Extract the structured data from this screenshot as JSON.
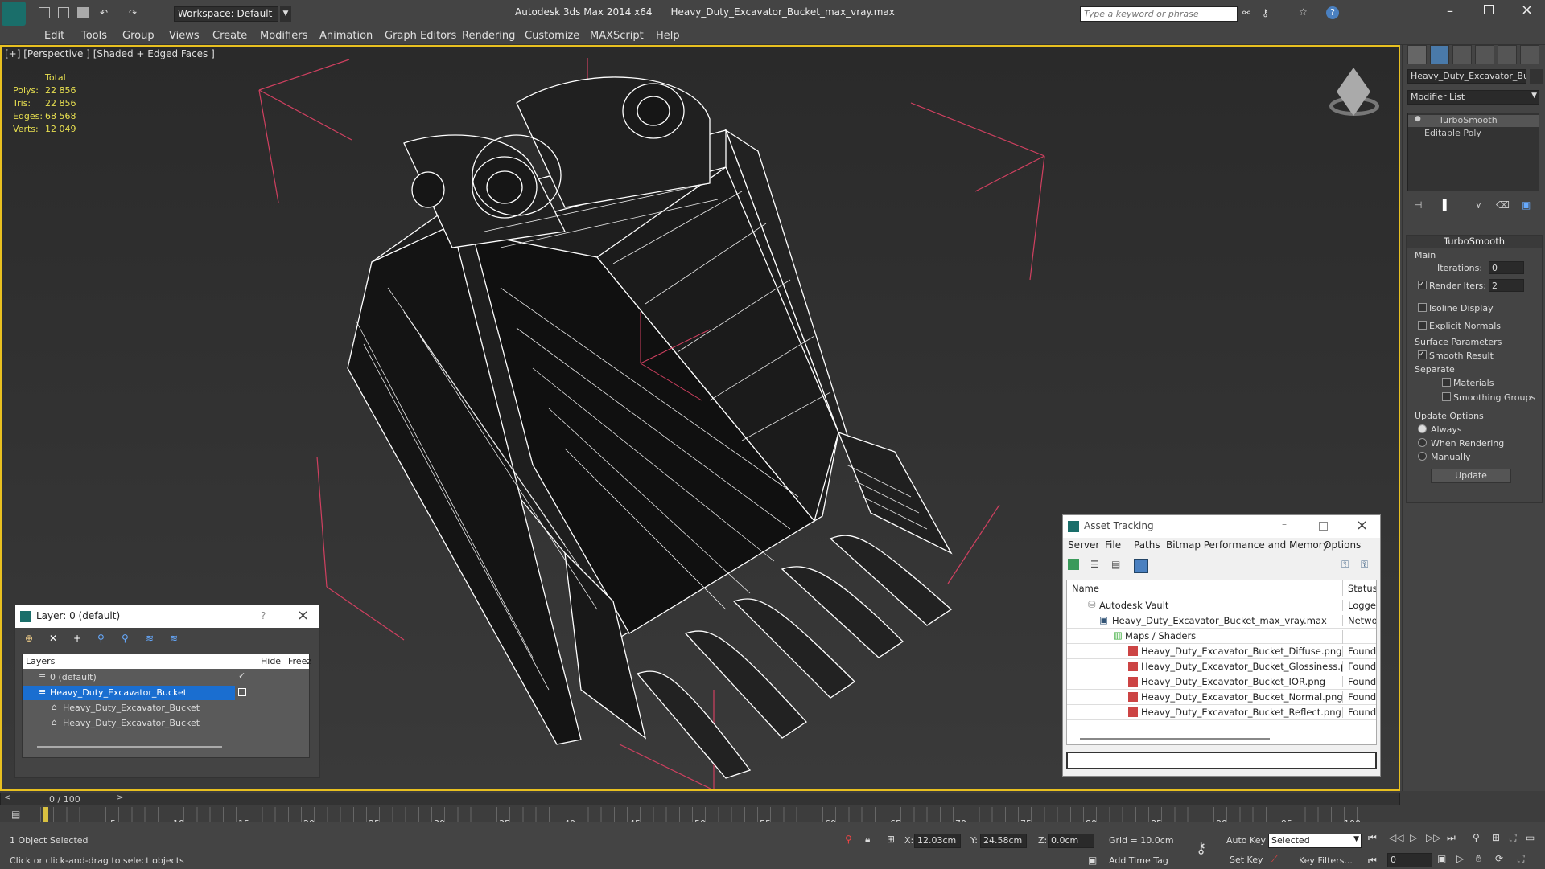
{
  "title_bar": {
    "app": "Autodesk 3ds Max  2014 x64",
    "file": "Heavy_Duty_Excavator_Bucket_max_vray.max",
    "workspace": "Workspace: Default",
    "search_placeholder": "Type a keyword or phrase"
  },
  "menu": [
    "Edit",
    "Tools",
    "Group",
    "Views",
    "Create",
    "Modifiers",
    "Animation",
    "Graph Editors",
    "Rendering",
    "Customize",
    "MAXScript",
    "Help"
  ],
  "viewport": {
    "label": "[+] [Perspective ] [Shaded + Edged Faces ]",
    "stats": {
      "total": "Total",
      "polys_l": "Polys:",
      "polys": "22 856",
      "tris_l": "Tris:",
      "tris": "22 856",
      "edges_l": "Edges:",
      "edges": "68 568",
      "verts_l": "Verts:",
      "verts": "12 049"
    }
  },
  "command_panel": {
    "object_name": "Heavy_Duty_Excavator_Buck",
    "modifier_list": "Modifier List",
    "stack": [
      "TurboSmooth",
      "Editable Poly"
    ],
    "rollout": "TurboSmooth",
    "main": "Main",
    "iterations_l": "Iterations:",
    "iterations": "0",
    "render_iters_l": "Render Iters:",
    "render_iters": "2",
    "isoline": "Isoline Display",
    "explicit": "Explicit Normals",
    "surface": "Surface Parameters",
    "smooth": "Smooth Result",
    "separate": "Separate",
    "materials": "Materials",
    "smoothing": "Smoothing Groups",
    "update_options": "Update Options",
    "always": "Always",
    "when_rendering": "When Rendering",
    "manually": "Manually",
    "update_btn": "Update"
  },
  "layer_dialog": {
    "title": "Layer: 0 (default)",
    "help": "?",
    "col_layers": "Layers",
    "col_hide": "Hide",
    "col_freeze": "Freez",
    "rows": [
      "0 (default)",
      "Heavy_Duty_Excavator_Bucket",
      "Heavy_Duty_Excavator_Bucket",
      "Heavy_Duty_Excavator_Bucket"
    ]
  },
  "asset_dialog": {
    "title": "Asset Tracking",
    "menus": [
      "Server",
      "File",
      "Paths",
      "Bitmap Performance and Memory",
      "Options"
    ],
    "col_name": "Name",
    "col_status": "Status",
    "rows": [
      {
        "name": "Autodesk Vault",
        "status": "Logged"
      },
      {
        "name": "Heavy_Duty_Excavator_Bucket_max_vray.max",
        "status": "Network"
      },
      {
        "name": "Maps / Shaders",
        "status": ""
      },
      {
        "name": "Heavy_Duty_Excavator_Bucket_Diffuse.png",
        "status": "Found"
      },
      {
        "name": "Heavy_Duty_Excavator_Bucket_Glossiness.png",
        "status": "Found"
      },
      {
        "name": "Heavy_Duty_Excavator_Bucket_IOR.png",
        "status": "Found"
      },
      {
        "name": "Heavy_Duty_Excavator_Bucket_Normal.png",
        "status": "Found"
      },
      {
        "name": "Heavy_Duty_Excavator_Bucket_Reflect.png",
        "status": "Found"
      }
    ]
  },
  "timeline": {
    "frame": "0 / 100",
    "ticks": [
      "0",
      "5",
      "10",
      "15",
      "20",
      "25",
      "30",
      "35",
      "40",
      "45",
      "50",
      "55",
      "60",
      "65",
      "70",
      "75",
      "80",
      "85",
      "90",
      "95",
      "100"
    ]
  },
  "status": {
    "selected": "1 Object Selected",
    "hint": "Click or click-and-drag to select objects",
    "x_l": "X:",
    "x": "12.03cm",
    "y_l": "Y:",
    "y": "24.58cm",
    "z_l": "Z:",
    "z": "0.0cm",
    "grid": "Grid = 10.0cm",
    "auto_key": "Auto Key",
    "set_key": "Set Key",
    "key_mode": "Selected",
    "key_filters": "Key Filters...",
    "add_time_tag": "Add Time Tag",
    "frame_field": "0"
  }
}
